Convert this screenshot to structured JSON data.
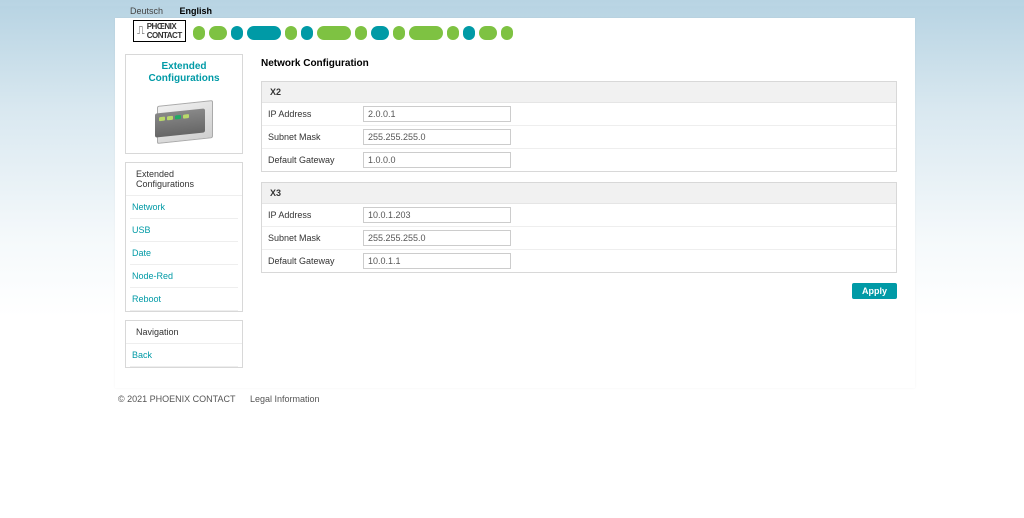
{
  "lang": {
    "deutsch": "Deutsch",
    "english": "English"
  },
  "logo": {
    "line1": "PHŒNIX",
    "line2": "CONTACT",
    "icon": "⎍"
  },
  "sidebar": {
    "title1": "Extended",
    "title2": "Configurations",
    "section1": "Extended Configurations",
    "items": [
      {
        "label": "Network"
      },
      {
        "label": "USB"
      },
      {
        "label": "Date"
      },
      {
        "label": "Node-Red"
      },
      {
        "label": "Reboot"
      }
    ],
    "section2": "Navigation",
    "back": "Back"
  },
  "main": {
    "title": "Network Configuration",
    "labels": {
      "ip": "IP Address",
      "mask": "Subnet Mask",
      "gw": "Default Gateway"
    },
    "x2": {
      "name": "X2",
      "ip": "2.0.0.1",
      "mask": "255.255.255.0",
      "gw": "1.0.0.0"
    },
    "x3": {
      "name": "X3",
      "ip": "10.0.1.203",
      "mask": "255.255.255.0",
      "gw": "10.0.1.1"
    },
    "apply": "Apply"
  },
  "footer": {
    "copyright": "© 2021 PHOENIX CONTACT",
    "legal": "Legal Information"
  }
}
